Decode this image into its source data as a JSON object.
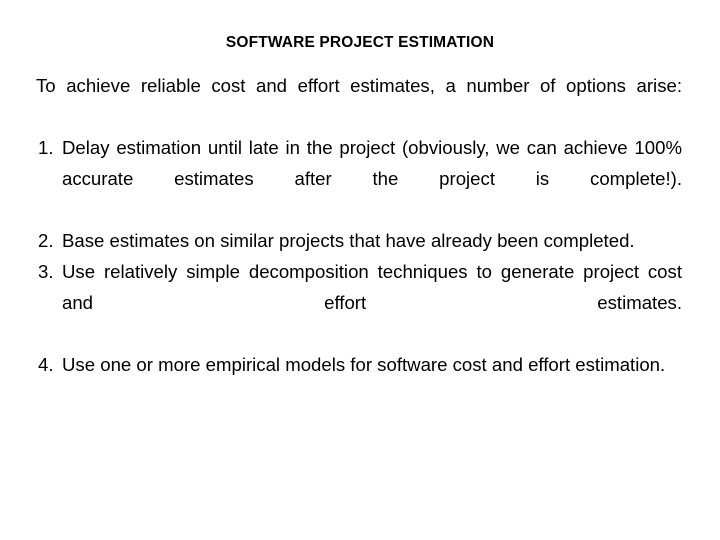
{
  "slide": {
    "title": "SOFTWARE PROJECT ESTIMATION",
    "intro": "To achieve reliable cost and effort estimates, a number of options arise:",
    "options": [
      {
        "marker": "1.",
        "text": "Delay estimation until late in the project (obviously, we can achieve 100% accurate estimates after the project is complete!)."
      },
      {
        "marker": "2.",
        "text": "Base estimates on similar projects that have already been completed."
      },
      {
        "marker": "3.",
        "text": "Use relatively simple decomposition techniques to generate project cost and effort estimates."
      },
      {
        "marker": "4.",
        "text": "Use one or more empirical models for software cost and effort estimation."
      }
    ]
  },
  "colors": {
    "background": "#ffffff",
    "text": "#000000"
  }
}
